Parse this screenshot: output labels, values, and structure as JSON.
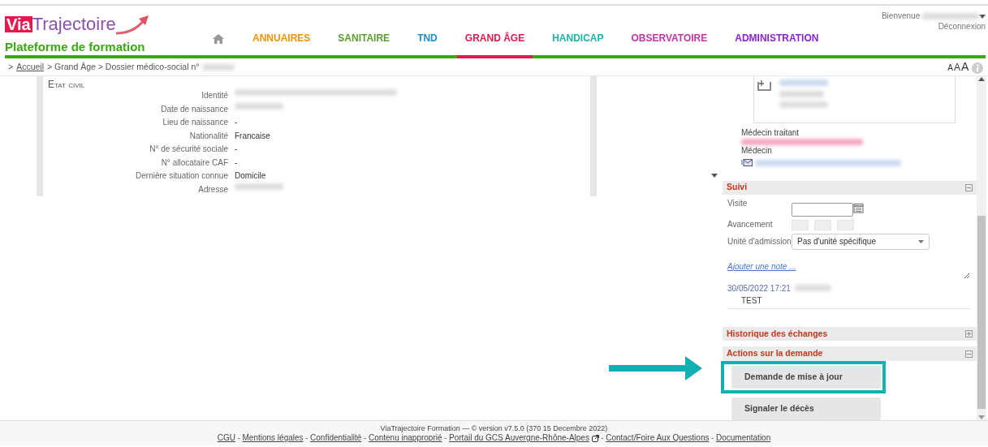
{
  "header": {
    "logo": {
      "part_1": "Via",
      "part_2": "Trajectoire"
    },
    "subtitle": "Plateforme de formation",
    "welcome": "Bienvenue",
    "welcome_name_redacted": true,
    "logout": "Déconnexion"
  },
  "nav": [
    {
      "kind": "home",
      "selected": false
    },
    {
      "kind": "link",
      "label": "ANNUAIRES",
      "color": "#f39200",
      "selected": false
    },
    {
      "kind": "link",
      "label": "SANITAIRE",
      "color": "#5a9e2f",
      "selected": false
    },
    {
      "kind": "link",
      "label": "TND",
      "color": "#1e8fc8",
      "selected": false
    },
    {
      "kind": "link",
      "label": "GRAND ÂGE",
      "color": "#e5194f",
      "selected": true
    },
    {
      "kind": "link",
      "label": "HANDICAP",
      "color": "#1db3a5",
      "selected": false
    },
    {
      "kind": "link",
      "label": "OBSERVATOIRE",
      "color": "#c334a8",
      "selected": false
    },
    {
      "kind": "link",
      "label": "ADMINISTRATION",
      "color": "#8b22d6",
      "selected": false
    }
  ],
  "breadcrumb": [
    {
      "kind": "text",
      "text": ">"
    },
    {
      "kind": "link",
      "text": "Accueil"
    },
    {
      "kind": "text",
      "text": "> Grand Âge > Dossier médico-social n°"
    },
    {
      "kind": "redacted"
    }
  ],
  "font_size_controls": [
    "A",
    "A",
    "A"
  ],
  "civil_status": {
    "title": "Etat civil",
    "rows": [
      {
        "label": "Identité",
        "redacted": true
      },
      {
        "label": "Date de naissance",
        "redacted": true
      },
      {
        "label": "Lieu de naissance",
        "value": "-"
      },
      {
        "label": "Nationalité",
        "value": "Francaise"
      },
      {
        "label": "N° de sécurité sociale",
        "value": "-"
      },
      {
        "label": "N° allocataire CAF",
        "value": "-"
      },
      {
        "label": "Dernière situation connue",
        "value": "Domicile"
      },
      {
        "label": "Adresse",
        "redacted": true
      }
    ]
  },
  "side": {
    "doctor_label": "Médecin traitant",
    "doctor_role": "Médecin",
    "sections": [
      {
        "kind": "suivi",
        "title": "Suivi",
        "expanded": true,
        "visit_label": "Visite",
        "progress_label": "Avancement",
        "unit_label": "Unité d'admission",
        "unit_value": "Pas d'unité spécifique",
        "add_note": "Ajouter une note ...",
        "note": {
          "date": "30/05/2022 17:21",
          "text": "TEST"
        }
      },
      {
        "kind": "plain",
        "title": "Historique des échanges",
        "expanded": false
      },
      {
        "kind": "actions",
        "title": "Actions sur la demande",
        "expanded": true,
        "buttons": [
          {
            "label": "Demande de mise à jour",
            "highlighted": true
          },
          {
            "label": "Signaler le décès",
            "highlighted": false
          }
        ]
      }
    ]
  },
  "footer": {
    "version": "ViaTrajectoire Formation — © version v7.5.0 (370 15 Decembre 2022)",
    "items": [
      {
        "kind": "link",
        "text": "CGU"
      },
      {
        "kind": "sep",
        "text": "-"
      },
      {
        "kind": "link",
        "text": "Mentions légales"
      },
      {
        "kind": "sep",
        "text": "-"
      },
      {
        "kind": "link",
        "text": "Confidentialité"
      },
      {
        "kind": "sep",
        "text": "-"
      },
      {
        "kind": "link",
        "text": "Contenu inapproprié"
      },
      {
        "kind": "sep",
        "text": "-"
      },
      {
        "kind": "link",
        "text": "Portail du GCS Auvergne-Rhône-Alpes",
        "external": true
      },
      {
        "kind": "sep",
        "text": "-"
      },
      {
        "kind": "link",
        "text": "Contact/Foire Aux Questions"
      },
      {
        "kind": "sep",
        "text": "-"
      },
      {
        "kind": "link",
        "text": "Documentation"
      }
    ]
  }
}
